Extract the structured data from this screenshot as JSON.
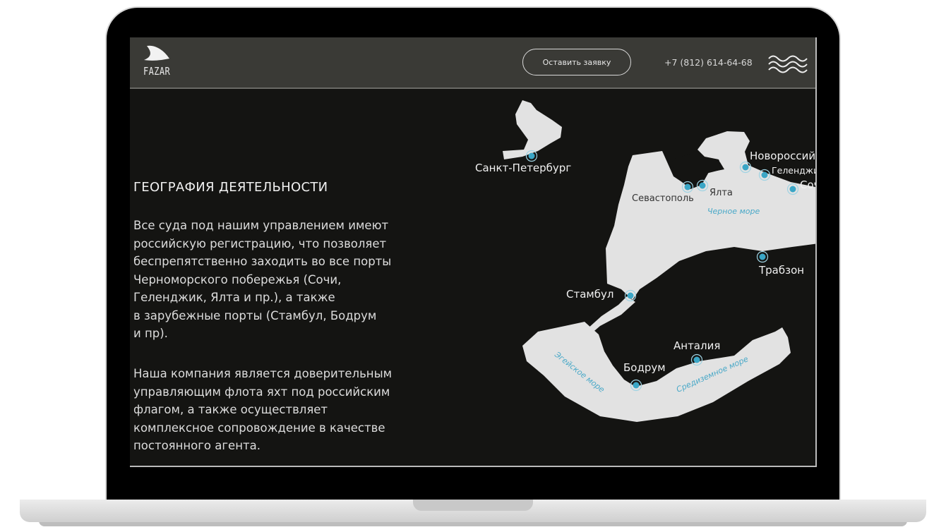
{
  "header": {
    "logo_text": "FAZAR",
    "cta_label": "Оставить заявку",
    "phone": "+7 (812) 614-64-68",
    "menu_icon": "waves-menu-icon"
  },
  "content": {
    "title": "ГЕОГРАФИЯ ДЕЯТЕЛЬНОСТИ",
    "paragraph1": "Все суда под нашим управлением имеют\nроссийскую регистрацию, что позволяет\nбеспрепятственно заходить во все порты\nЧерноморского побережья (Сочи,\nГеленджик, Ялта и пр.), а также\nв зарубежные порты (Стамбул, Бодрум\nи пр).",
    "paragraph2": "Наша компания является доверительным\nуправляющим флота яхт под российским\nфлагом, а также осуществляет\nкомплексное сопровождение в качестве\nпостоянного агента."
  },
  "map": {
    "ports": [
      "Санкт-Петербург",
      "Новороссийск",
      "Геленджик",
      "Сочи",
      "Севастополь",
      "Ялта",
      "Трабзон",
      "Стамбул",
      "Анталия",
      "Бодрум"
    ],
    "seas": [
      "Черное море",
      "Эгейское море",
      "Средиземное море"
    ],
    "colors": {
      "sea": "#e2e2e2",
      "land": "#141412",
      "marker": "#3aa6c6"
    }
  }
}
